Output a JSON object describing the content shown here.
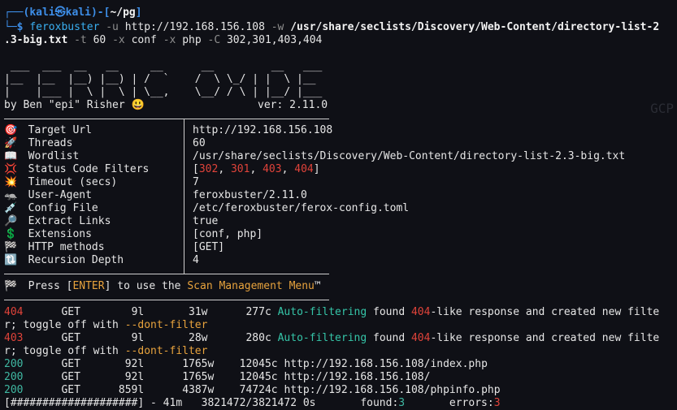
{
  "prompt": {
    "box_top": "┌──(",
    "user": "kali",
    "at": "㉿",
    "host": "kali",
    "mid": ")-[",
    "cwd": "~/pg",
    "end": "]",
    "box_bottom": "└─",
    "dollar": "$"
  },
  "command": {
    "bin": "feroxbuster",
    "flag_u": "-u",
    "url": "http://192.168.156.108",
    "flag_w": "-w",
    "wordlist_a": "/usr/share/seclists/Discovery/Web-Content/directory-list-2",
    "wordlist_b": ".3-big.txt",
    "flag_t": "-t",
    "threads": "60",
    "flag_x1": "-x",
    "ext1": "conf",
    "flag_x2": "-x",
    "ext2": "php",
    "flag_C": "-C",
    "codes": "302,301,403,404"
  },
  "banner": {
    "art1": " ___  ___  __   __     __      __         __   ___",
    "art2": "|__  |__  |__) |__) | /  `    /  \\ \\_/ | |  \\ |__",
    "art3": "|    |___ |  \\ |  \\ | \\__,    \\__/ / \\ | |__/ |___",
    "author": "by Ben \"epi\" Risher",
    "smile": "😃",
    "version": "ver: 2.11.0"
  },
  "config": [
    {
      "icon": "🎯",
      "icon_name": "target-icon",
      "label": "Target Url",
      "value": "http://192.168.156.108"
    },
    {
      "icon": "🚀",
      "icon_name": "rocket-icon",
      "label": "Threads",
      "value": "60"
    },
    {
      "icon": "📖",
      "icon_name": "book-icon",
      "label": "Wordlist",
      "value": "/usr/share/seclists/Discovery/Web-Content/directory-list-2.3-big.txt"
    },
    {
      "icon": "💢",
      "icon_name": "anger-icon",
      "label": "Status Code Filters",
      "value": ""
    },
    {
      "icon": "💥",
      "icon_name": "collision-icon",
      "label": "Timeout (secs)",
      "value": "7"
    },
    {
      "icon": "🦡",
      "icon_name": "badger-icon",
      "label": "User-Agent",
      "value": "feroxbuster/2.11.0"
    },
    {
      "icon": "💉",
      "icon_name": "syringe-icon",
      "label": "Config File",
      "value": "/etc/feroxbuster/ferox-config.toml"
    },
    {
      "icon": "🔎",
      "icon_name": "magnifier-icon",
      "label": "Extract Links",
      "value": "true"
    },
    {
      "icon": "💲",
      "icon_name": "dollar-icon",
      "label": "Extensions",
      "value": "[conf, php]"
    },
    {
      "icon": "🏁",
      "icon_name": "checkered-flag-icon",
      "label": "HTTP methods",
      "value": "[GET]"
    },
    {
      "icon": "🔃",
      "icon_name": "refresh-icon",
      "label": "Recursion Depth",
      "value": "4"
    }
  ],
  "status_filters": {
    "open": "[",
    "codes": [
      "302",
      "301",
      "403",
      "404"
    ],
    "sep": ", ",
    "close": "]"
  },
  "menu_hint": {
    "icon": "🏁",
    "pre": "Press [",
    "key": "ENTER",
    "mid": "] to use the ",
    "menu": "Scan Management Menu",
    "tm": "™"
  },
  "results": [
    {
      "code": "404",
      "method": "GET",
      "lines": "9l",
      "words": "31w",
      "chars": "277c",
      "text_a": "Auto-filtering",
      "text_b": " found ",
      "text_c": "404",
      "text_d": "-like response and created new filte"
    },
    {
      "code": "403",
      "method": "GET",
      "lines": "9l",
      "words": "28w",
      "chars": "280c",
      "text_a": "Auto-filtering",
      "text_b": " found ",
      "text_c": "404",
      "text_d": "-like response and created new filte"
    },
    {
      "code": "200",
      "method": "GET",
      "lines": "92l",
      "words": "1765w",
      "chars": "12045c",
      "url": "http://192.168.156.108/index.php"
    },
    {
      "code": "200",
      "method": "GET",
      "lines": "92l",
      "words": "1765w",
      "chars": "12045c",
      "url": "http://192.168.156.108/"
    },
    {
      "code": "200",
      "method": "GET",
      "lines": "859l",
      "words": "4387w",
      "chars": "74724c",
      "url": "http://192.168.156.108/phpinfo.php"
    }
  ],
  "wrap": {
    "pre": "r; toggle off with ",
    "flag": "--dont-filter"
  },
  "progress": {
    "bar": "[####################]",
    "stats": " - 41m   3821472/3821472",
    "eta": "0s",
    "found_label": "found:",
    "found": "3",
    "errors_label": "errors:",
    "errors": "3"
  },
  "watermark": "GCP"
}
